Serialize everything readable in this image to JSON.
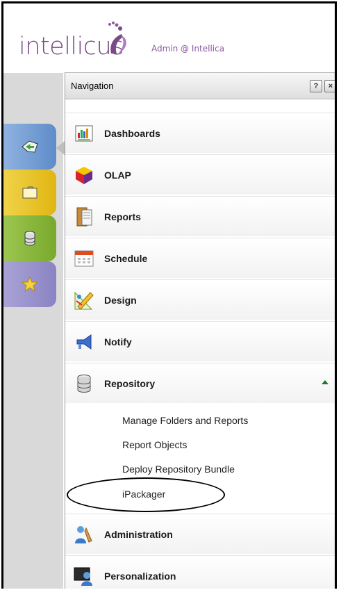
{
  "header": {
    "logo_text": "intellicus",
    "user_label": "Admin @ Intellica"
  },
  "side_tabs": [
    {
      "name": "navigation-tab",
      "icon": "arrow-icon"
    },
    {
      "name": "folder-tab",
      "icon": "folder-icon"
    },
    {
      "name": "repository-tab",
      "icon": "database-icon"
    },
    {
      "name": "favorites-tab",
      "icon": "star-icon"
    }
  ],
  "panel": {
    "title": "Navigation",
    "help_label": "?",
    "close_label": "×",
    "items": [
      {
        "label": "Dashboards",
        "icon": "dashboard-icon"
      },
      {
        "label": "OLAP",
        "icon": "olap-cube-icon"
      },
      {
        "label": "Reports",
        "icon": "reports-icon"
      },
      {
        "label": "Schedule",
        "icon": "calendar-icon"
      },
      {
        "label": "Design",
        "icon": "design-icon"
      },
      {
        "label": "Notify",
        "icon": "megaphone-icon"
      },
      {
        "label": "Repository",
        "icon": "database-icon",
        "expanded": true
      },
      {
        "label": "Administration",
        "icon": "admin-icon"
      },
      {
        "label": "Personalization",
        "icon": "personalization-icon"
      }
    ],
    "repository_subitems": [
      "Manage Folders and Reports",
      "Report Objects",
      "Deploy Repository Bundle",
      "iPackager"
    ]
  }
}
